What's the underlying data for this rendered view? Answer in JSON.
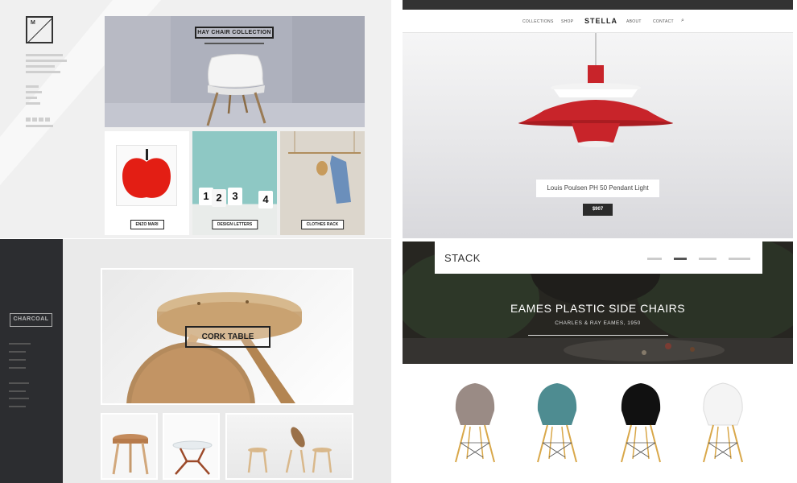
{
  "minimal": {
    "logo_letter": "M",
    "hero_tag": "HAY CHAIR COLLECTION",
    "thumbs": [
      {
        "tag": "ENZO MARI"
      },
      {
        "tag": "DESIGN LETTERS",
        "digits": [
          "1",
          "2",
          "3",
          "4"
        ]
      },
      {
        "tag": "CLOTHES RACK"
      }
    ]
  },
  "stella": {
    "brand": "STELLA",
    "nav": [
      "COLLECTIONS",
      "SHOP",
      "ABOUT",
      "CONTACT"
    ],
    "product_caption": "Louis Poulsen PH 50 Pendant Light",
    "price": "$907",
    "lamp_color": "#c8242a"
  },
  "charcoal": {
    "brand": "CHARCOAL",
    "hero_tag": "CORK TABLE"
  },
  "stack": {
    "brand": "STACK",
    "slide_count": 4,
    "active_slide": 2,
    "title": "EAMES PLASTIC SIDE CHAIRS",
    "subtitle": "CHARLES & RAY EAMES, 1950",
    "chairs": [
      {
        "color": "#9a8b85"
      },
      {
        "color": "#4e8c91"
      },
      {
        "color": "#111111"
      },
      {
        "color": "#f4f4f4"
      }
    ]
  }
}
